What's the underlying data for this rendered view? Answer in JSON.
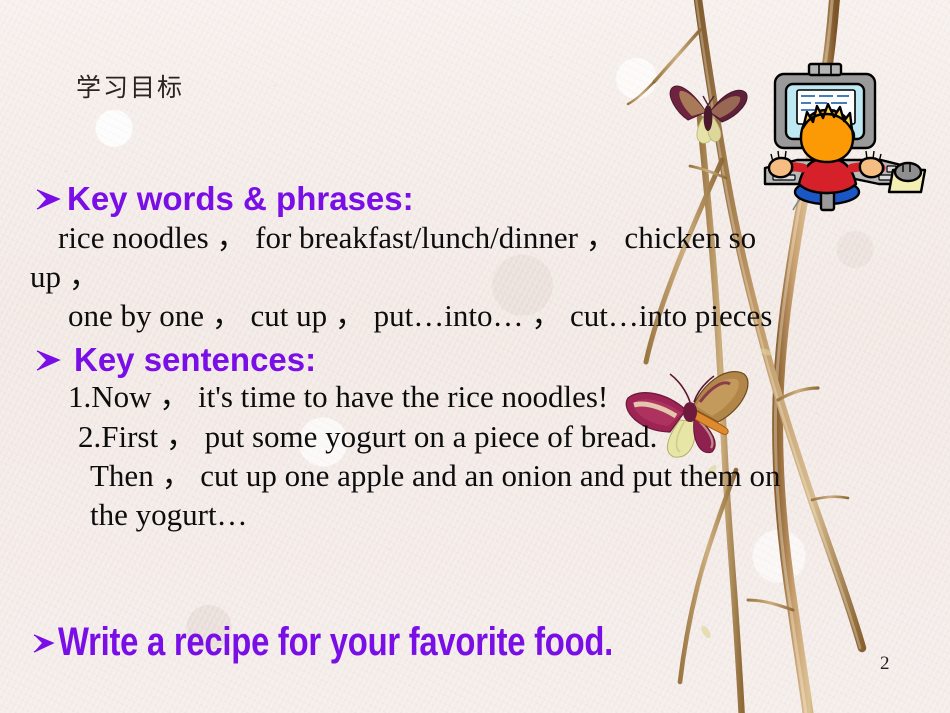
{
  "slide": {
    "title": "学习目标",
    "page_number": "2",
    "background_color": "#f2eae7",
    "accent_color": "#7a0ee6",
    "text_color": "#0d0d0d"
  },
  "sections": [
    {
      "heading": "Key words & phrases:",
      "bullet_icon": "arrow-bullet-icon",
      "lines": [
        "rice noodles ，  for breakfast/lunch/dinner ，  chicken so",
        "up ，",
        "one by one ，  cut up ，  put…into… ，  cut…into pieces"
      ]
    },
    {
      "heading": "Key sentences:",
      "bullet_icon": "arrow-bullet-icon",
      "lines": [
        "1.Now ，  it's time to have the rice noodles!",
        "2.First ，  put some yogurt on a piece of bread.",
        "Then ，  cut up one apple and an onion and put them on",
        "the yogurt…"
      ]
    }
  ],
  "final_task": {
    "bullet_icon": "arrow-bullet-icon",
    "text": "Write a recipe for your favorite food."
  },
  "decorations": [
    {
      "name": "computer-kid-clipart",
      "description": "boy at a computer with monitor, keyboard and mouse"
    },
    {
      "name": "butterfly-top-clipart",
      "description": "small purple and tan butterfly on a branch"
    },
    {
      "name": "butterfly-middle-clipart",
      "description": "large magenta and yellow butterfly on a branch"
    },
    {
      "name": "branch-decoration",
      "description": "dry tree branches along the right side"
    }
  ]
}
